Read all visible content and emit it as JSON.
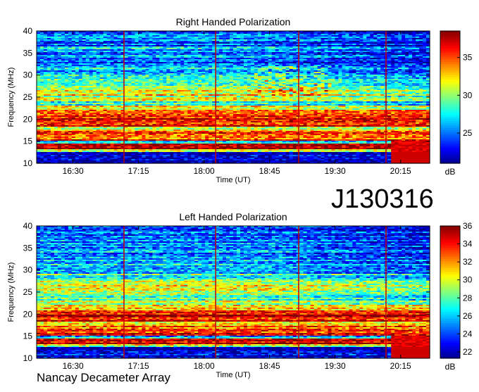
{
  "chart_data": [
    {
      "type": "heatmap",
      "title": "Right Handed Polarization",
      "xlabel": "Time (UT)",
      "ylabel": "Frequency (MHz)",
      "xlim": [
        "16:05",
        "20:35"
      ],
      "ylim": [
        10,
        40
      ],
      "x_ticks": [
        "16:30",
        "17:15",
        "18:00",
        "18:45",
        "19:30",
        "20:15"
      ],
      "y_ticks": [
        10,
        15,
        20,
        25,
        30,
        35,
        40
      ],
      "colorbar": {
        "unit": "dB",
        "range": [
          21,
          38.5
        ],
        "ticks": [
          25,
          30,
          35
        ]
      },
      "colormap": [
        "#00008f",
        "#0000ff",
        "#00ffff",
        "#ffff00",
        "#ff0000",
        "#800000"
      ],
      "vertical_lines_ut": [
        "17:05",
        "18:08",
        "19:05",
        "20:05"
      ]
    },
    {
      "type": "heatmap",
      "title": "Left Handed Polarization",
      "xlabel": "Time (UT)",
      "ylabel": "Frequency (MHz)",
      "xlim": [
        "16:05",
        "20:35"
      ],
      "ylim": [
        10,
        40
      ],
      "x_ticks": [
        "16:30",
        "17:15",
        "18:00",
        "18:45",
        "19:30",
        "20:15"
      ],
      "y_ticks": [
        10,
        15,
        20,
        25,
        30,
        35,
        40
      ],
      "colorbar": {
        "unit": "dB",
        "range": [
          21.3,
          36
        ],
        "ticks": [
          22,
          24,
          26,
          28,
          30,
          32,
          34,
          36
        ]
      },
      "colormap": [
        "#00008f",
        "#0000ff",
        "#00ffff",
        "#ffff00",
        "#ff0000",
        "#800000"
      ],
      "vertical_lines_ut": [
        "17:05",
        "18:08",
        "19:05",
        "20:05"
      ]
    }
  ],
  "observation_id": "J130316",
  "instrument": "Nancay Decameter Array"
}
